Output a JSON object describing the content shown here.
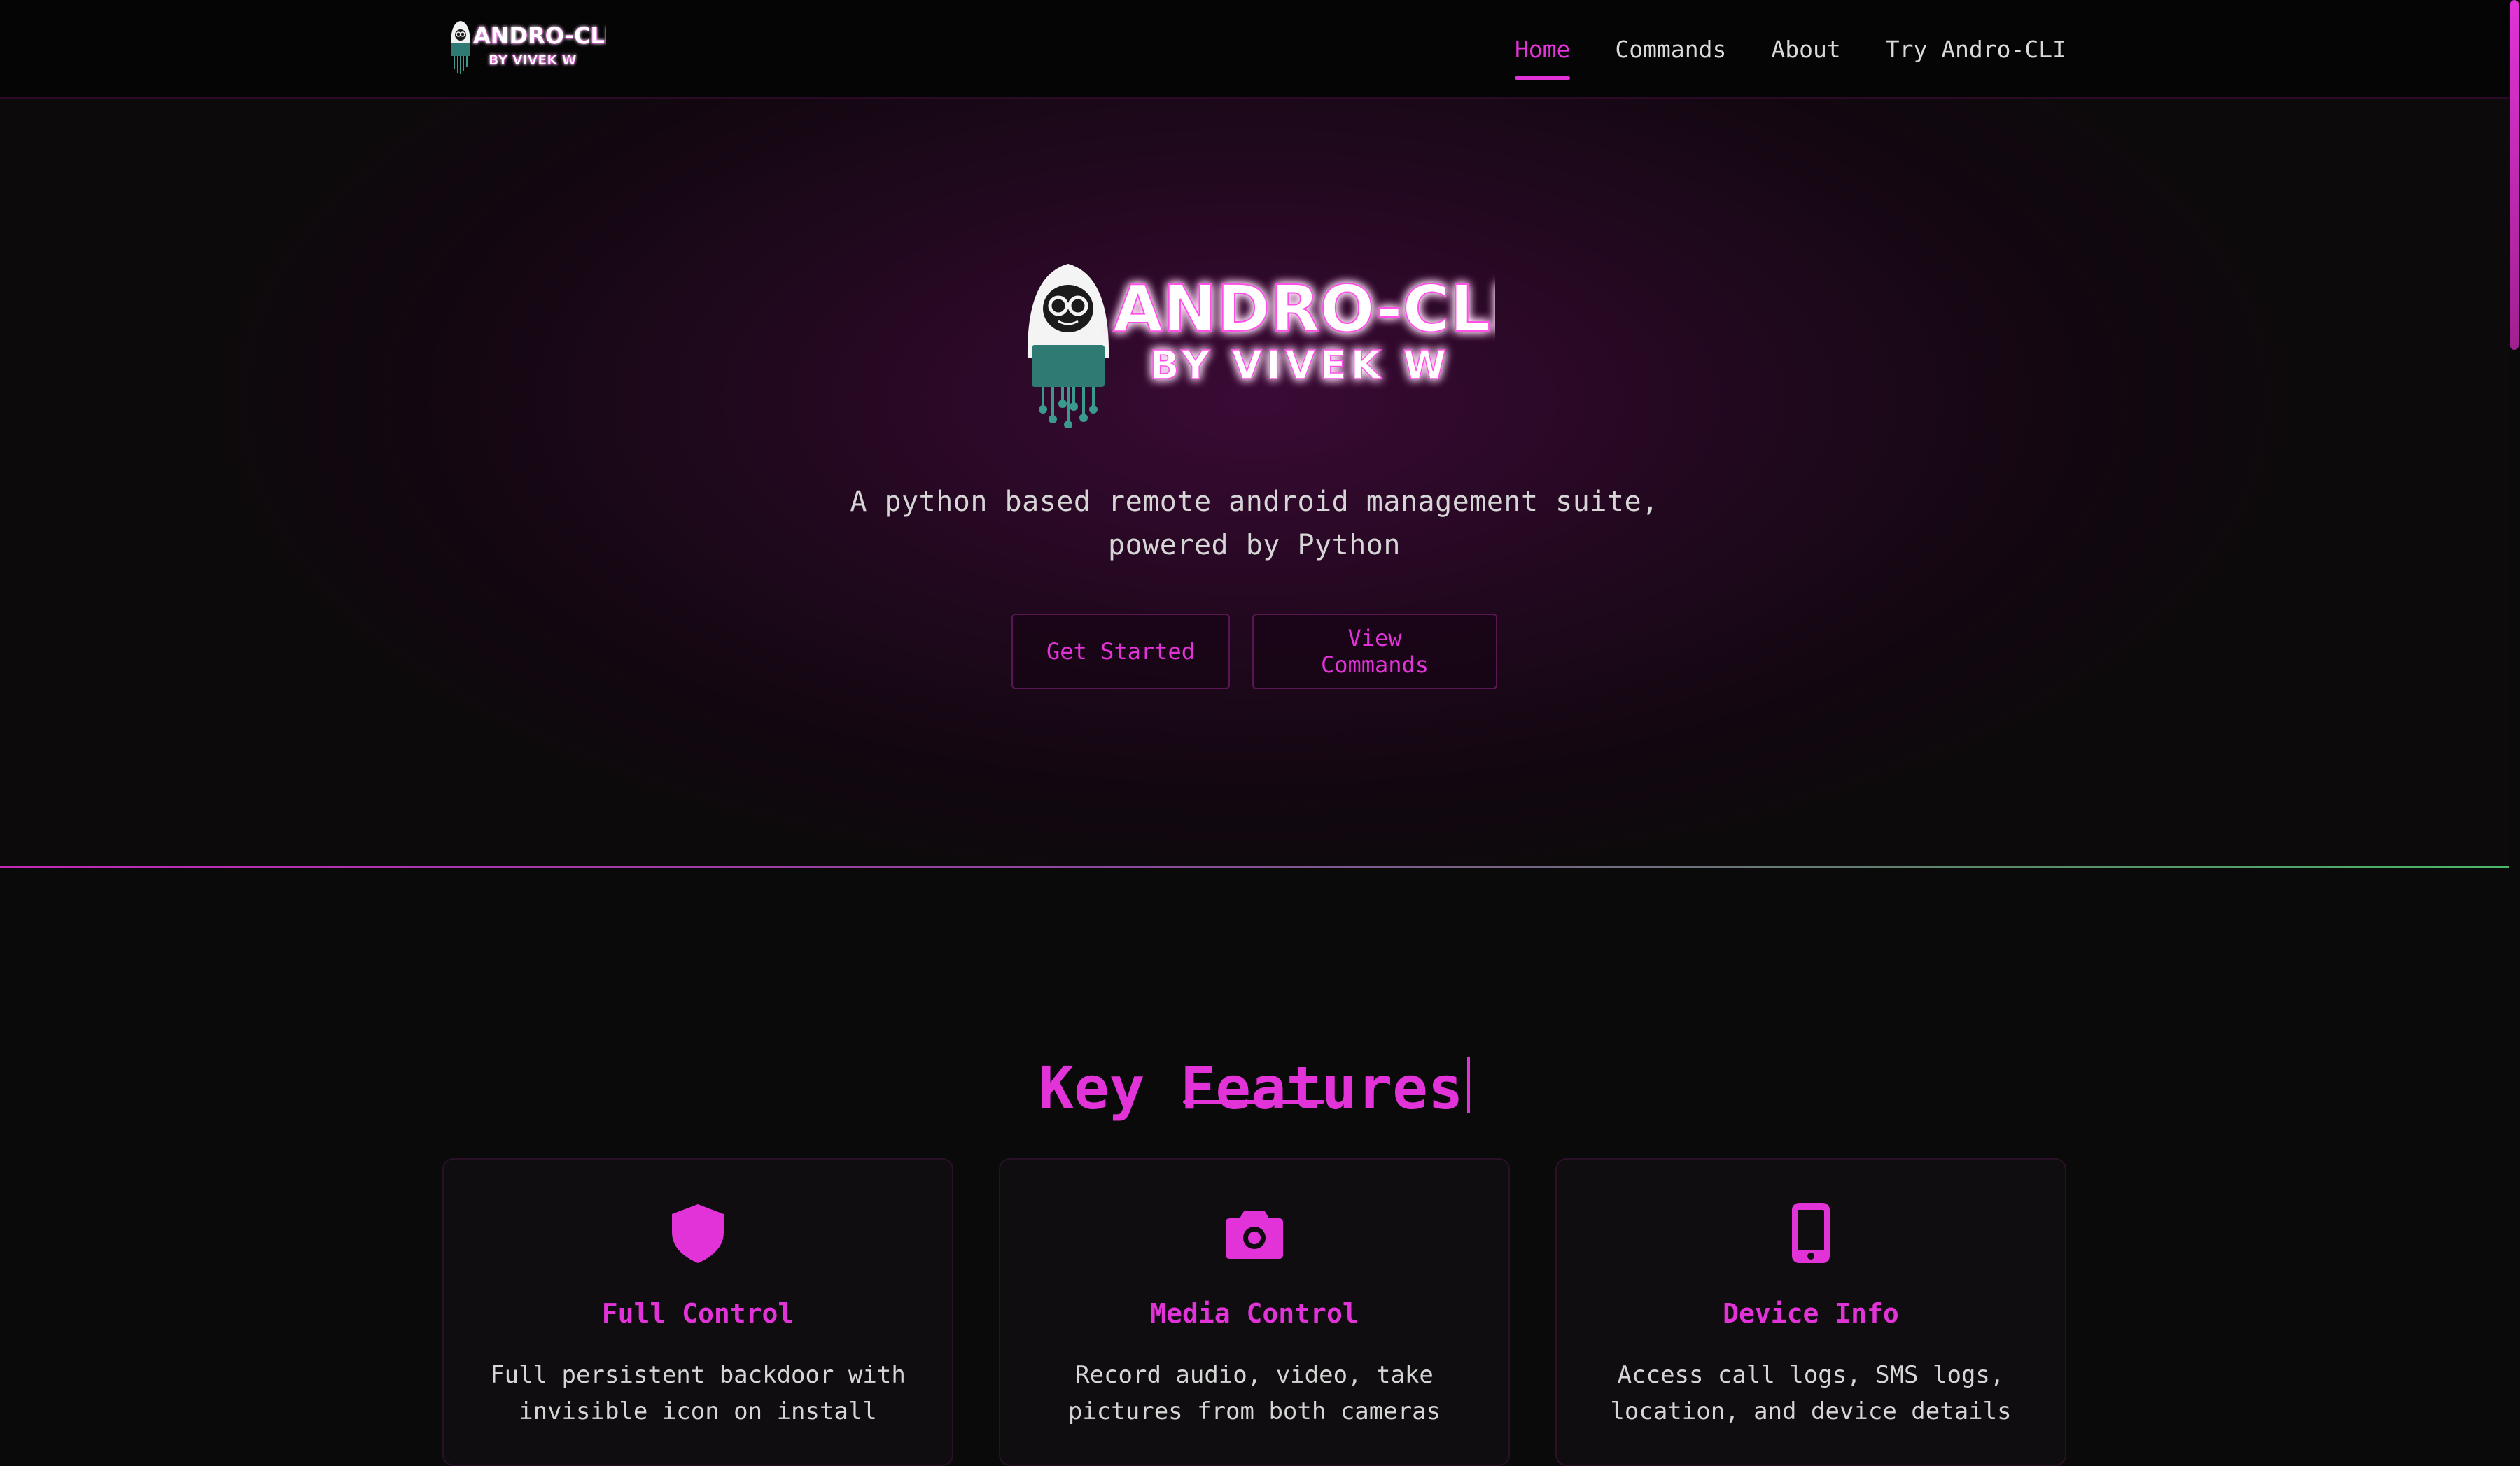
{
  "nav": {
    "logo": {
      "title": "ANDRO-CLI",
      "subtitle": "BY VIVEK W"
    },
    "links": [
      {
        "label": "Home",
        "active": true
      },
      {
        "label": "Commands",
        "active": false
      },
      {
        "label": "About",
        "active": false
      },
      {
        "label": "Try Andro-CLI",
        "active": false
      }
    ]
  },
  "hero": {
    "logo": {
      "title": "ANDRO-CLI",
      "subtitle": "BY VIVEK W"
    },
    "subtitle_line1": "A python based remote android management suite,",
    "subtitle_line2": "powered by Python",
    "buttons": {
      "get_started": "Get Started",
      "view_commands": "View Commands"
    }
  },
  "features": {
    "title": "Key Features",
    "cards": [
      {
        "icon": "shield-icon",
        "title": "Full Control",
        "desc_line1": "Full persistent backdoor with",
        "desc_line2": "invisible icon on install"
      },
      {
        "icon": "camera-icon",
        "title": "Media Control",
        "desc_line1": "Record audio, video, take",
        "desc_line2": "pictures from both cameras"
      },
      {
        "icon": "mobile-phone-icon",
        "title": "Device Info",
        "desc_line1": "Access call logs, SMS logs,",
        "desc_line2": "location, and device details"
      }
    ]
  },
  "colors": {
    "accent": "#e233d8",
    "background": "#0a0a0b",
    "navbar": "#050505",
    "text": "#d8d8d8",
    "logo_teal": "#3b9a8f"
  }
}
